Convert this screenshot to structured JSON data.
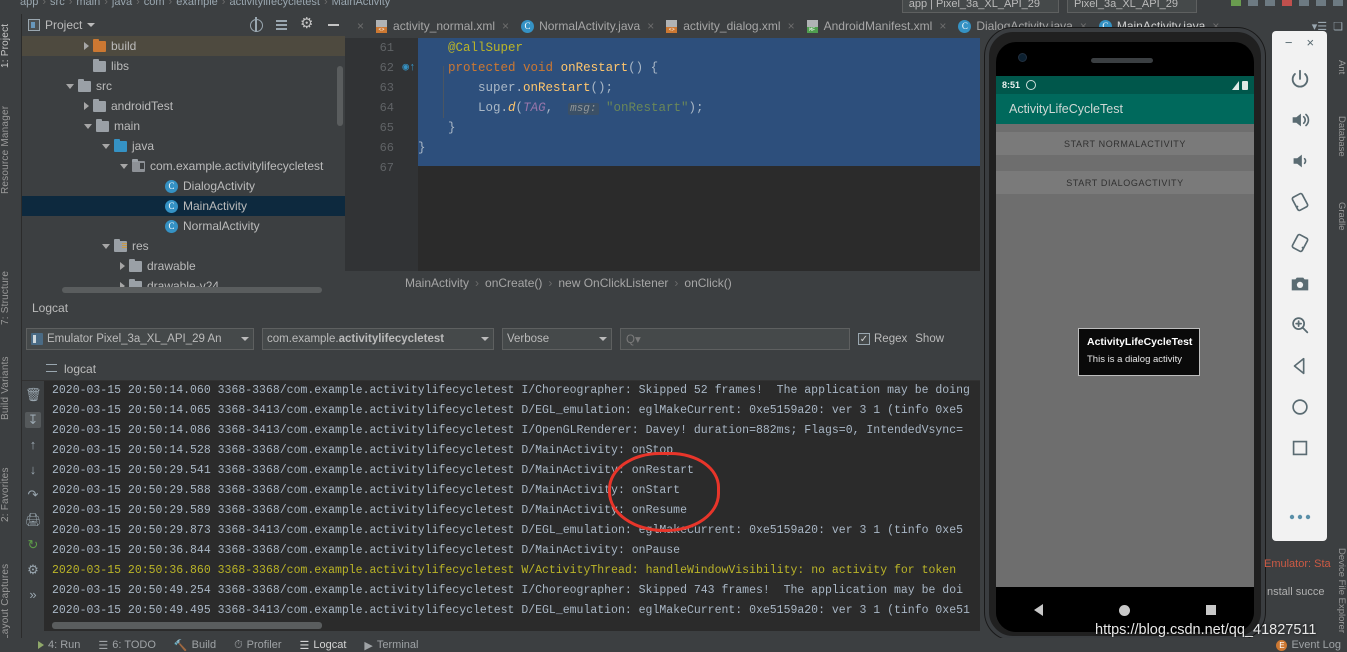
{
  "top_breadcrumb": {
    "items": [
      "app",
      "src",
      "main",
      "java",
      "com",
      "example",
      "activitylifecycletest",
      "MainActivity"
    ],
    "run_config": "app | Pixel_3a_XL_API_29",
    "device": "Pixel_3a_XL_API_29"
  },
  "project_panel": {
    "title": "Project",
    "tree": [
      {
        "label": "build",
        "depth": 3,
        "arrow": "right",
        "icon": "folder-orange",
        "state": "highlight"
      },
      {
        "label": "libs",
        "depth": 3,
        "arrow": "none",
        "icon": "folder"
      },
      {
        "label": "src",
        "depth": 2,
        "arrow": "down",
        "icon": "folder"
      },
      {
        "label": "androidTest",
        "depth": 3,
        "arrow": "right",
        "icon": "folder"
      },
      {
        "label": "main",
        "depth": 3,
        "arrow": "down",
        "icon": "folder"
      },
      {
        "label": "java",
        "depth": 4,
        "arrow": "down",
        "icon": "folder-blue"
      },
      {
        "label": "com.example.activitylifecycletest",
        "depth": 5,
        "arrow": "down",
        "icon": "folder-pkg"
      },
      {
        "label": "DialogActivity",
        "depth": 7,
        "arrow": "none",
        "icon": "class"
      },
      {
        "label": "MainActivity",
        "depth": 7,
        "arrow": "none",
        "icon": "class",
        "state": "selected"
      },
      {
        "label": "NormalActivity",
        "depth": 7,
        "arrow": "none",
        "icon": "class"
      },
      {
        "label": "res",
        "depth": 4,
        "arrow": "down",
        "icon": "folder-res"
      },
      {
        "label": "drawable",
        "depth": 5,
        "arrow": "right",
        "icon": "folder"
      },
      {
        "label": "drawable-v24",
        "depth": 5,
        "arrow": "right",
        "icon": "folder"
      }
    ]
  },
  "left_strip": {
    "labels": [
      "1: Project",
      "Resource Manager",
      "7: Structure",
      "Build Variants",
      "2: Favorites",
      "Layout Captures"
    ]
  },
  "right_strip": {
    "labels": [
      "Ant",
      "Database",
      "Gradle",
      "Device File Explorer"
    ]
  },
  "editor_tabs": [
    {
      "label": "activity_normal.xml",
      "icon": "xml-icon",
      "active": false
    },
    {
      "label": "NormalActivity.java",
      "icon": "java-class-icon",
      "active": false
    },
    {
      "label": "activity_dialog.xml",
      "icon": "xml-icon",
      "active": false
    },
    {
      "label": "AndroidManifest.xml",
      "icon": "manifest-icon",
      "active": false
    },
    {
      "label": "DialogActivity.java",
      "icon": "java-class-icon",
      "active": false
    },
    {
      "label": "MainActivity.java",
      "icon": "java-class-icon",
      "active": true
    }
  ],
  "editor": {
    "lines": [
      {
        "no": "61",
        "text": "@CallSuper",
        "kind": "annotation"
      },
      {
        "no": "62",
        "text": "protected void onRestart() {",
        "kind": "signature"
      },
      {
        "no": "63",
        "text": "super.onRestart();",
        "kind": "call"
      },
      {
        "no": "64",
        "text": "Log.d(TAG,  msg: \"onRestart\");",
        "kind": "log"
      },
      {
        "no": "65",
        "text": "}",
        "kind": "brace"
      },
      {
        "no": "66",
        "text": "}",
        "kind": "brace"
      },
      {
        "no": "67",
        "text": "",
        "kind": "empty"
      }
    ],
    "code": {
      "annotation": "@CallSuper",
      "kw_protected": "protected",
      "kw_void": "void",
      "method_name": "onRestart",
      "sig_tail": "() {",
      "super_call": "super.",
      "super_method": "onRestart",
      "super_tail": "();",
      "log_obj": "Log.",
      "log_method": "d",
      "log_open": "(",
      "log_tag": "TAG",
      "log_comma": ", ",
      "log_hint": "msg:",
      "log_str": "\"onRestart\"",
      "log_close": ");",
      "brace": "}"
    },
    "breadcrumb": [
      "MainActivity",
      "onCreate()",
      "new OnClickListener",
      "onClick()"
    ]
  },
  "logcat": {
    "title": "Logcat",
    "device_selector": "Emulator Pixel_3a_XL_API_29 An",
    "process_selector_prefix": "com.example.",
    "process_selector_bold": "activitylifecycletest",
    "level_selector": "Verbose",
    "search_placeholder": "Q▾",
    "regex_label": "Regex",
    "show_label": "Show",
    "regex_checked": true,
    "tab_label": "logcat",
    "lines": [
      {
        "time": "2020-03-15 20:50:14.060",
        "pid": "3368-3368",
        "pkg": "com.example.activitylifecycletest",
        "tag": "I/Choreographer:",
        "msg": "Skipped 52 frames!  The application may be doing",
        "level": "I"
      },
      {
        "time": "2020-03-15 20:50:14.065",
        "pid": "3368-3413",
        "pkg": "com.example.activitylifecycletest",
        "tag": "D/EGL_emulation:",
        "msg": "eglMakeCurrent: 0xe5159a20: ver 3 1 (tinfo 0xe5",
        "level": "D"
      },
      {
        "time": "2020-03-15 20:50:14.086",
        "pid": "3368-3413",
        "pkg": "com.example.activitylifecycletest",
        "tag": "I/OpenGLRenderer:",
        "msg": "Davey! duration=882ms; Flags=0, IntendedVsync=",
        "level": "I"
      },
      {
        "time": "2020-03-15 20:50:14.528",
        "pid": "3368-3368",
        "pkg": "com.example.activitylifecycletest",
        "tag": "D/MainActivity:",
        "msg": "onStop",
        "level": "D"
      },
      {
        "time": "2020-03-15 20:50:29.541",
        "pid": "3368-3368",
        "pkg": "com.example.activitylifecycletest",
        "tag": "D/MainActivity:",
        "msg": "onRestart",
        "level": "D"
      },
      {
        "time": "2020-03-15 20:50:29.588",
        "pid": "3368-3368",
        "pkg": "com.example.activitylifecycletest",
        "tag": "D/MainActivity:",
        "msg": "onStart",
        "level": "D"
      },
      {
        "time": "2020-03-15 20:50:29.589",
        "pid": "3368-3368",
        "pkg": "com.example.activitylifecycletest",
        "tag": "D/MainActivity:",
        "msg": "onResume",
        "level": "D"
      },
      {
        "time": "2020-03-15 20:50:29.873",
        "pid": "3368-3413",
        "pkg": "com.example.activitylifecycletest",
        "tag": "D/EGL_emulation:",
        "msg": "eglMakeCurrent: 0xe5159a20: ver 3 1 (tinfo 0xe5",
        "level": "D"
      },
      {
        "time": "2020-03-15 20:50:36.844",
        "pid": "3368-3368",
        "pkg": "com.example.activitylifecycletest",
        "tag": "D/MainActivity:",
        "msg": "onPause",
        "level": "D"
      },
      {
        "time": "2020-03-15 20:50:36.860",
        "pid": "3368-3368",
        "pkg": "com.example.activitylifecycletest",
        "tag": "W/ActivityThread:",
        "msg": "handleWindowVisibility: no activity for token",
        "level": "W"
      },
      {
        "time": "2020-03-15 20:50:49.254",
        "pid": "3368-3368",
        "pkg": "com.example.activitylifecycletest",
        "tag": "I/Choreographer:",
        "msg": "Skipped 743 frames!  The application may be doi",
        "level": "I"
      },
      {
        "time": "2020-03-15 20:50:49.495",
        "pid": "3368-3413",
        "pkg": "com.example.activitylifecycletest",
        "tag": "D/EGL_emulation:",
        "msg": "eglMakeCurrent: 0xe5159a20: ver 3 1 (tinfo 0xe51",
        "level": "D"
      }
    ],
    "annotation_color": "#e8352a"
  },
  "emulator": {
    "status_time": "8:51",
    "app_title": "ActivityLifeCycleTest",
    "buttons": [
      {
        "label": "START NORMALACTIVITY"
      },
      {
        "label": "START DIALOGACTIVITY"
      }
    ],
    "dialog": {
      "title": "ActivityLifeCycleTest",
      "body": "This is a dialog activity"
    },
    "toolbar_icons": [
      "power-icon",
      "volume-up-icon",
      "volume-down-icon",
      "rotate-left-icon",
      "rotate-right-icon",
      "screenshot-camera-icon",
      "zoom-icon",
      "back-nav-icon",
      "home-nav-icon",
      "overview-nav-icon",
      "more-options-icon"
    ],
    "window_buttons": [
      "minimize-icon",
      "close-icon"
    ],
    "status_text": "Emulator: Sta",
    "status_text2": "nstall succe"
  },
  "status_bar": {
    "items": [
      "4: Run",
      "6: TODO",
      "Build",
      "Profiler",
      "Logcat",
      "Terminal"
    ],
    "active": "Logcat",
    "event_log": "Event Log"
  },
  "watermark": "https://blog.csdn.net/qq_41827511"
}
